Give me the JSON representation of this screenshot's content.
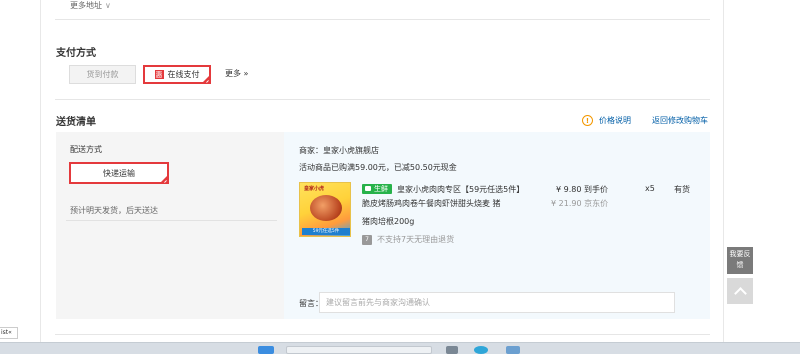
{
  "address": {
    "more_label": "更多地址",
    "more_icon": "chevron-down-icon"
  },
  "payment": {
    "title": "支付方式",
    "options": [
      {
        "label": "货到付款",
        "selected": false
      },
      {
        "label": "在线支付",
        "selected": true
      }
    ],
    "selected_icon_text": "惠",
    "more_label": "更多 »"
  },
  "delivery": {
    "title": "送货清单",
    "price_note": "价格说明",
    "price_note_icon": "!",
    "back_cart": "返回修改购物车",
    "ship_label": "配送方式",
    "ship_method": "快递运输",
    "ship_note": "预计明天发货，后天送达"
  },
  "order": {
    "shop": "商家：皇家小虎旗舰店",
    "promo": "活动商品已购满59.00元，已减50.50元现金",
    "item": {
      "tag": "生鲜",
      "title": "皇家小虎肉肉专区【59元任选5件】脆皮烤肠鸡肉卷午餐肉虾饼甜头烧麦 猪",
      "spec": "猪肉培根200g",
      "thumb_brand": "皇家小虎",
      "thumb_banner": "59元任选5件",
      "price": "¥ 9.80 到手价",
      "orig_price": "¥ 21.90 京东价",
      "qty": "x5",
      "stock": "有货",
      "no_return": "不支持7天无理由退货",
      "no_return_icon": "7"
    },
    "message_label": "留言：",
    "message_placeholder": "建议留言前先与商家沟通确认"
  },
  "side": {
    "feedback": "我要反馈"
  },
  "tab_stub": "ist«",
  "colors": {
    "accent": "#e4393c",
    "link": "#005ea7",
    "warn": "#f39800",
    "fresh": "#27b24a"
  }
}
